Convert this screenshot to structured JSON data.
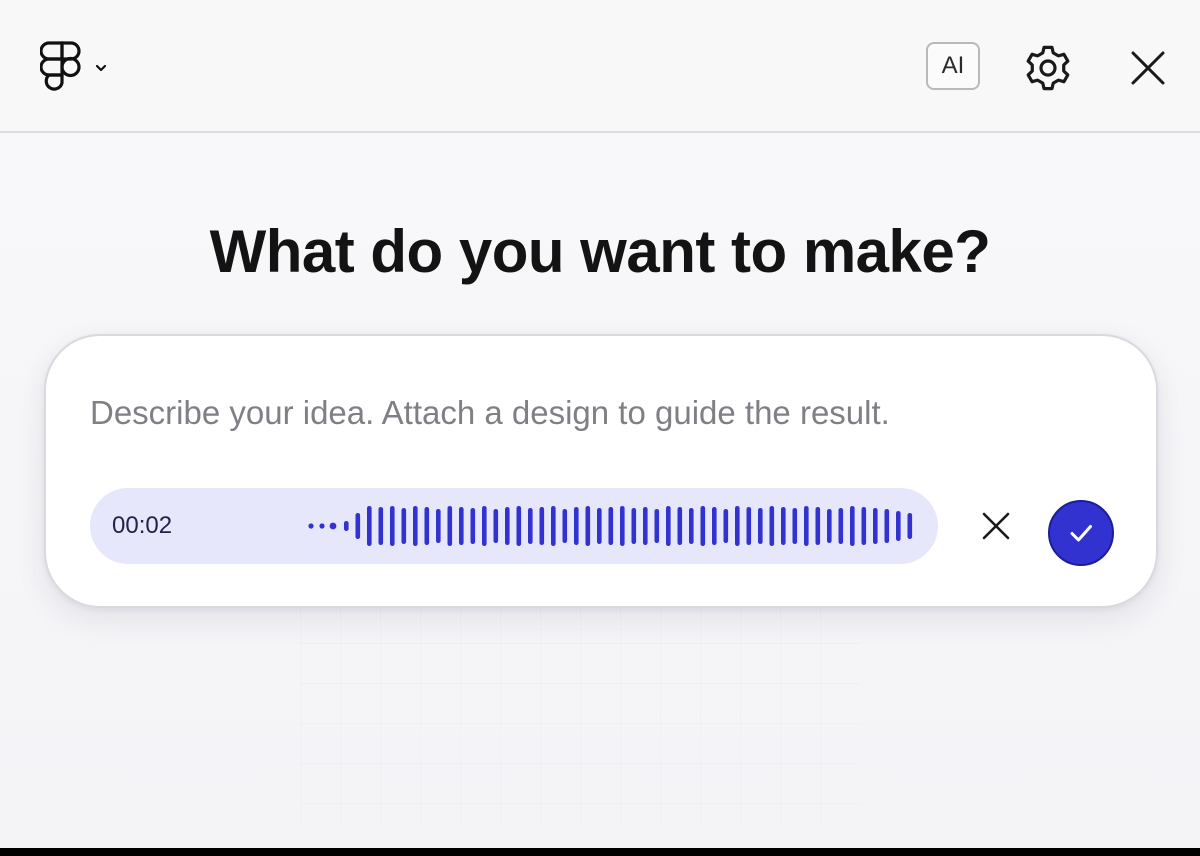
{
  "header": {
    "ai_label": "AI",
    "icons": [
      "figma-logo-icon",
      "chevron-down-icon",
      "gear-icon",
      "close-icon"
    ]
  },
  "main": {
    "heading": "What do you want to make?",
    "prompt": {
      "placeholder": "Describe your idea. Attach a design to guide the result.",
      "value": ""
    },
    "recording": {
      "elapsed": "00:02",
      "accent_color": "#3232d0",
      "pill_color": "#e6e7fa"
    }
  }
}
